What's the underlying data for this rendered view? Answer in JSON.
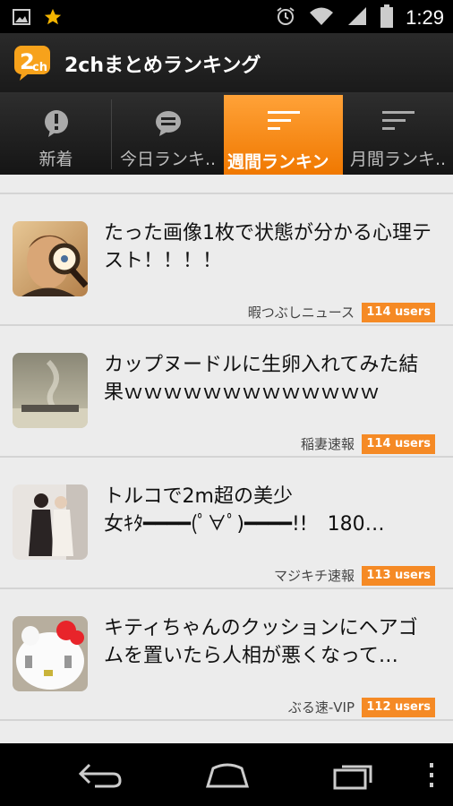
{
  "statusbar": {
    "time": "1:29"
  },
  "app": {
    "title": "2chまとめランキング"
  },
  "tabs": [
    {
      "label": "新着",
      "icon": "exclamation-bubble-icon"
    },
    {
      "label": "今日ランキ..",
      "icon": "chat-bubble-icon"
    },
    {
      "label": "週間ランキン",
      "icon": "ranking-lines-icon"
    },
    {
      "label": "月間ランキ..",
      "icon": "ranking-lines-icon"
    }
  ],
  "items": [
    {
      "title": "たった画像1枚で状態が分かる心理テ\nスト！！！！",
      "source": "暇つぶしニュース",
      "users": "114 users"
    },
    {
      "title": "カップヌードルに生卵入れてみた結\n果ｗｗｗｗｗｗｗｗｗｗｗｗｗ",
      "source": "稲妻速報",
      "users": "114 users"
    },
    {
      "title": "トルコで2m超の美少\n女ｷﾀ━━━━(ﾟ∀ﾟ)━━━━!!　180…",
      "source": "マジキチ速報",
      "users": "113 users"
    },
    {
      "title": "キティちゃんのクッションにヘアゴ\nムを置いたら人相が悪くなって…",
      "source": "ぶる速-VIP",
      "users": "112 users"
    }
  ],
  "colors": {
    "accent": "#f58a25",
    "tab_active": "#f98c1c"
  }
}
